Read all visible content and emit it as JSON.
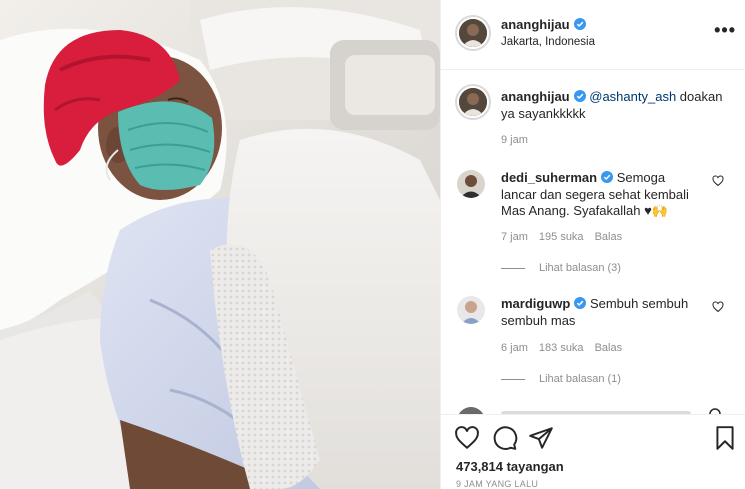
{
  "post": {
    "username": "ananghijau",
    "location": "Jakarta, Indonesia",
    "more_label": "•••"
  },
  "caption": {
    "username": "ananghijau",
    "mention": "@ashanty_ash",
    "text": " doakan ya sayankkkkk",
    "time": "9 jam"
  },
  "comments": [
    {
      "username": "dedi_suherman",
      "text": " Semoga lancar dan segera sehat kembali Mas Anang. Syafakallah ♥🙌",
      "time": "7 jam",
      "likes": "195 suka",
      "reply_label": "Balas",
      "view_replies": "Lihat balasan (3)"
    },
    {
      "username": "mardiguwp",
      "text": " Sembuh sembuh sembuh mas",
      "time": "6 jam",
      "likes": "183 suka",
      "reply_label": "Balas",
      "view_replies": "Lihat balasan (1)"
    }
  ],
  "stats": {
    "views": "473,814 tayangan",
    "posted": "9 JAM YANG LALU"
  },
  "icons": {
    "verified": "verified-badge-icon",
    "like": "heart-icon",
    "comment": "comment-icon",
    "share": "send-icon",
    "save": "bookmark-icon"
  },
  "colors": {
    "verified": "#3897f0",
    "text": "#262626",
    "secondary": "#8e8e8e",
    "mention": "#00376b",
    "cap": "#d81e3c",
    "mask": "#5bbcb2"
  }
}
